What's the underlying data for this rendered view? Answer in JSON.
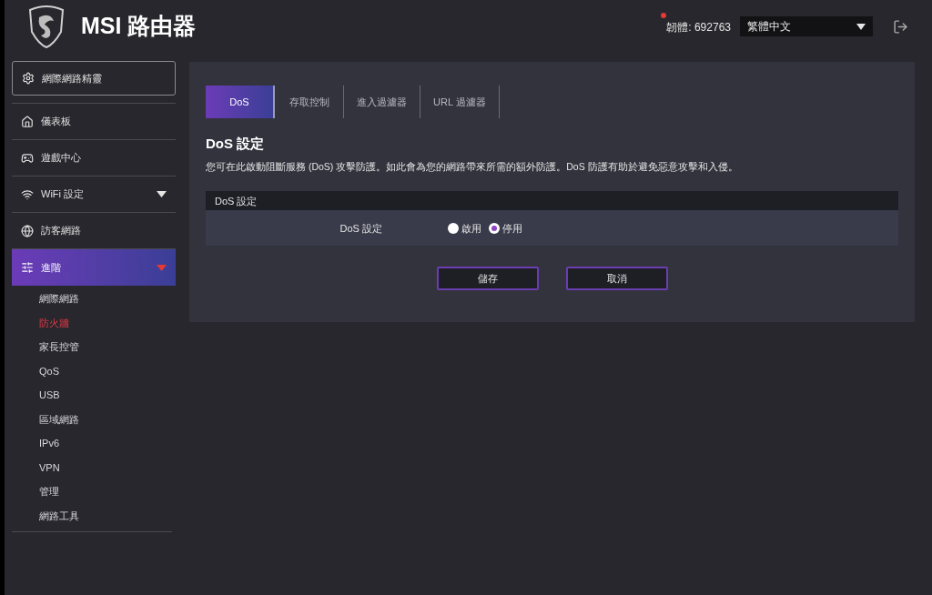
{
  "header": {
    "title": "MSI 路由器",
    "firmware": "韌體: 692763",
    "firmware_alert": true,
    "language": "繁體中文"
  },
  "sidebar": {
    "wizard": "網際網路精靈",
    "items": [
      {
        "label": "儀表板",
        "kind": "link",
        "selected": false
      },
      {
        "label": "遊戲中心",
        "kind": "link",
        "selected": false
      },
      {
        "label": "WiFi 設定",
        "kind": "group",
        "selected": false
      },
      {
        "label": "訪客網路",
        "kind": "link",
        "selected": false
      },
      {
        "label": "進階",
        "kind": "group",
        "selected": true,
        "children": [
          {
            "label": "網際網路",
            "selected": false
          },
          {
            "label": "防火牆",
            "selected": true
          },
          {
            "label": "家長控管",
            "selected": false
          },
          {
            "label": "QoS",
            "selected": false
          },
          {
            "label": "USB",
            "selected": false
          },
          {
            "label": "區域網路",
            "selected": false
          },
          {
            "label": "IPv6",
            "selected": false
          },
          {
            "label": "VPN",
            "selected": false
          },
          {
            "label": "管理",
            "selected": false
          },
          {
            "label": "網路工具",
            "selected": false
          }
        ]
      }
    ]
  },
  "tabs": [
    {
      "label": "DoS",
      "selected": true
    },
    {
      "label": "存取控制",
      "selected": false
    },
    {
      "label": "進入過濾器",
      "selected": false
    },
    {
      "label": "URL 過濾器",
      "selected": false
    }
  ],
  "section": {
    "title": "DoS 設定",
    "description": "您可在此啟動阻斷服務 (DoS) 攻擊防護。如此會為您的網路帶來所需的額外防護。DoS 防護有助於避免惡意攻擊和入侵。",
    "table_header": "DoS 設定",
    "field_label": "DoS 設定",
    "options": [
      {
        "label": "啟用",
        "selected": false
      },
      {
        "label": "停用",
        "selected": true
      }
    ]
  },
  "buttons": [
    "儲存",
    "取消"
  ]
}
